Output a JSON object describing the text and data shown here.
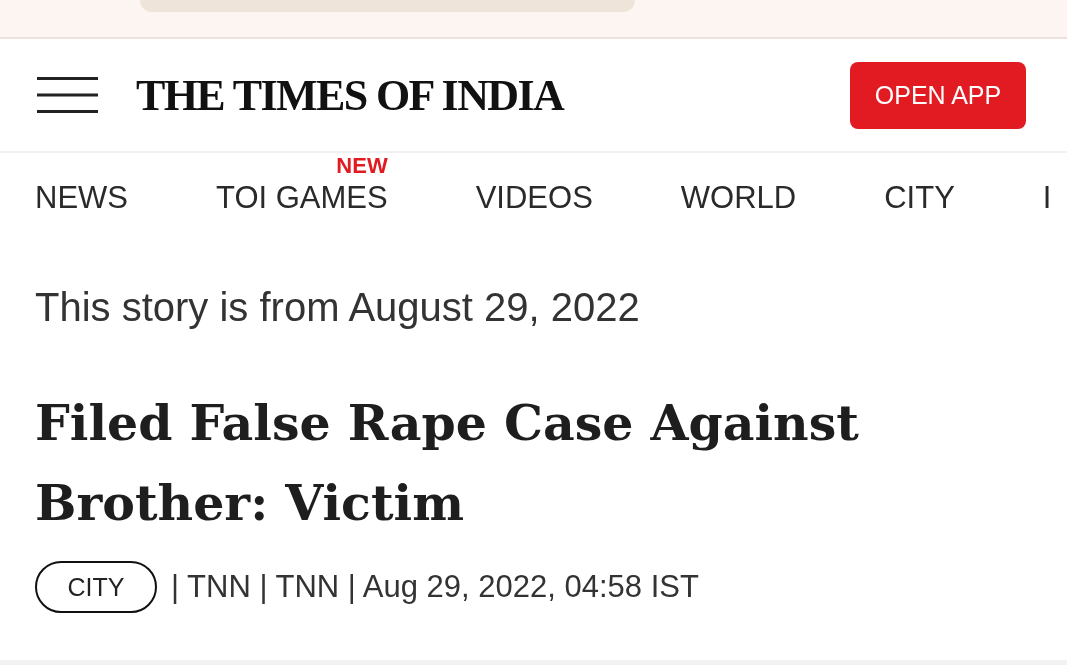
{
  "header": {
    "logo": "THE TIMES OF INDIA",
    "open_app_button": "OPEN APP"
  },
  "nav": {
    "items": [
      {
        "label": "NEWS"
      },
      {
        "label": "TOI GAMES",
        "badge": "NEW"
      },
      {
        "label": "VIDEOS"
      },
      {
        "label": "WORLD"
      },
      {
        "label": "CITY"
      },
      {
        "label": "I"
      }
    ]
  },
  "article": {
    "story_date_note": "This story is from August 29, 2022",
    "headline": "Filed False Rape Case Against Brother: Victim",
    "category": "CITY",
    "byline": "| TNN | TNN | Aug 29, 2022, 04:58 IST"
  }
}
